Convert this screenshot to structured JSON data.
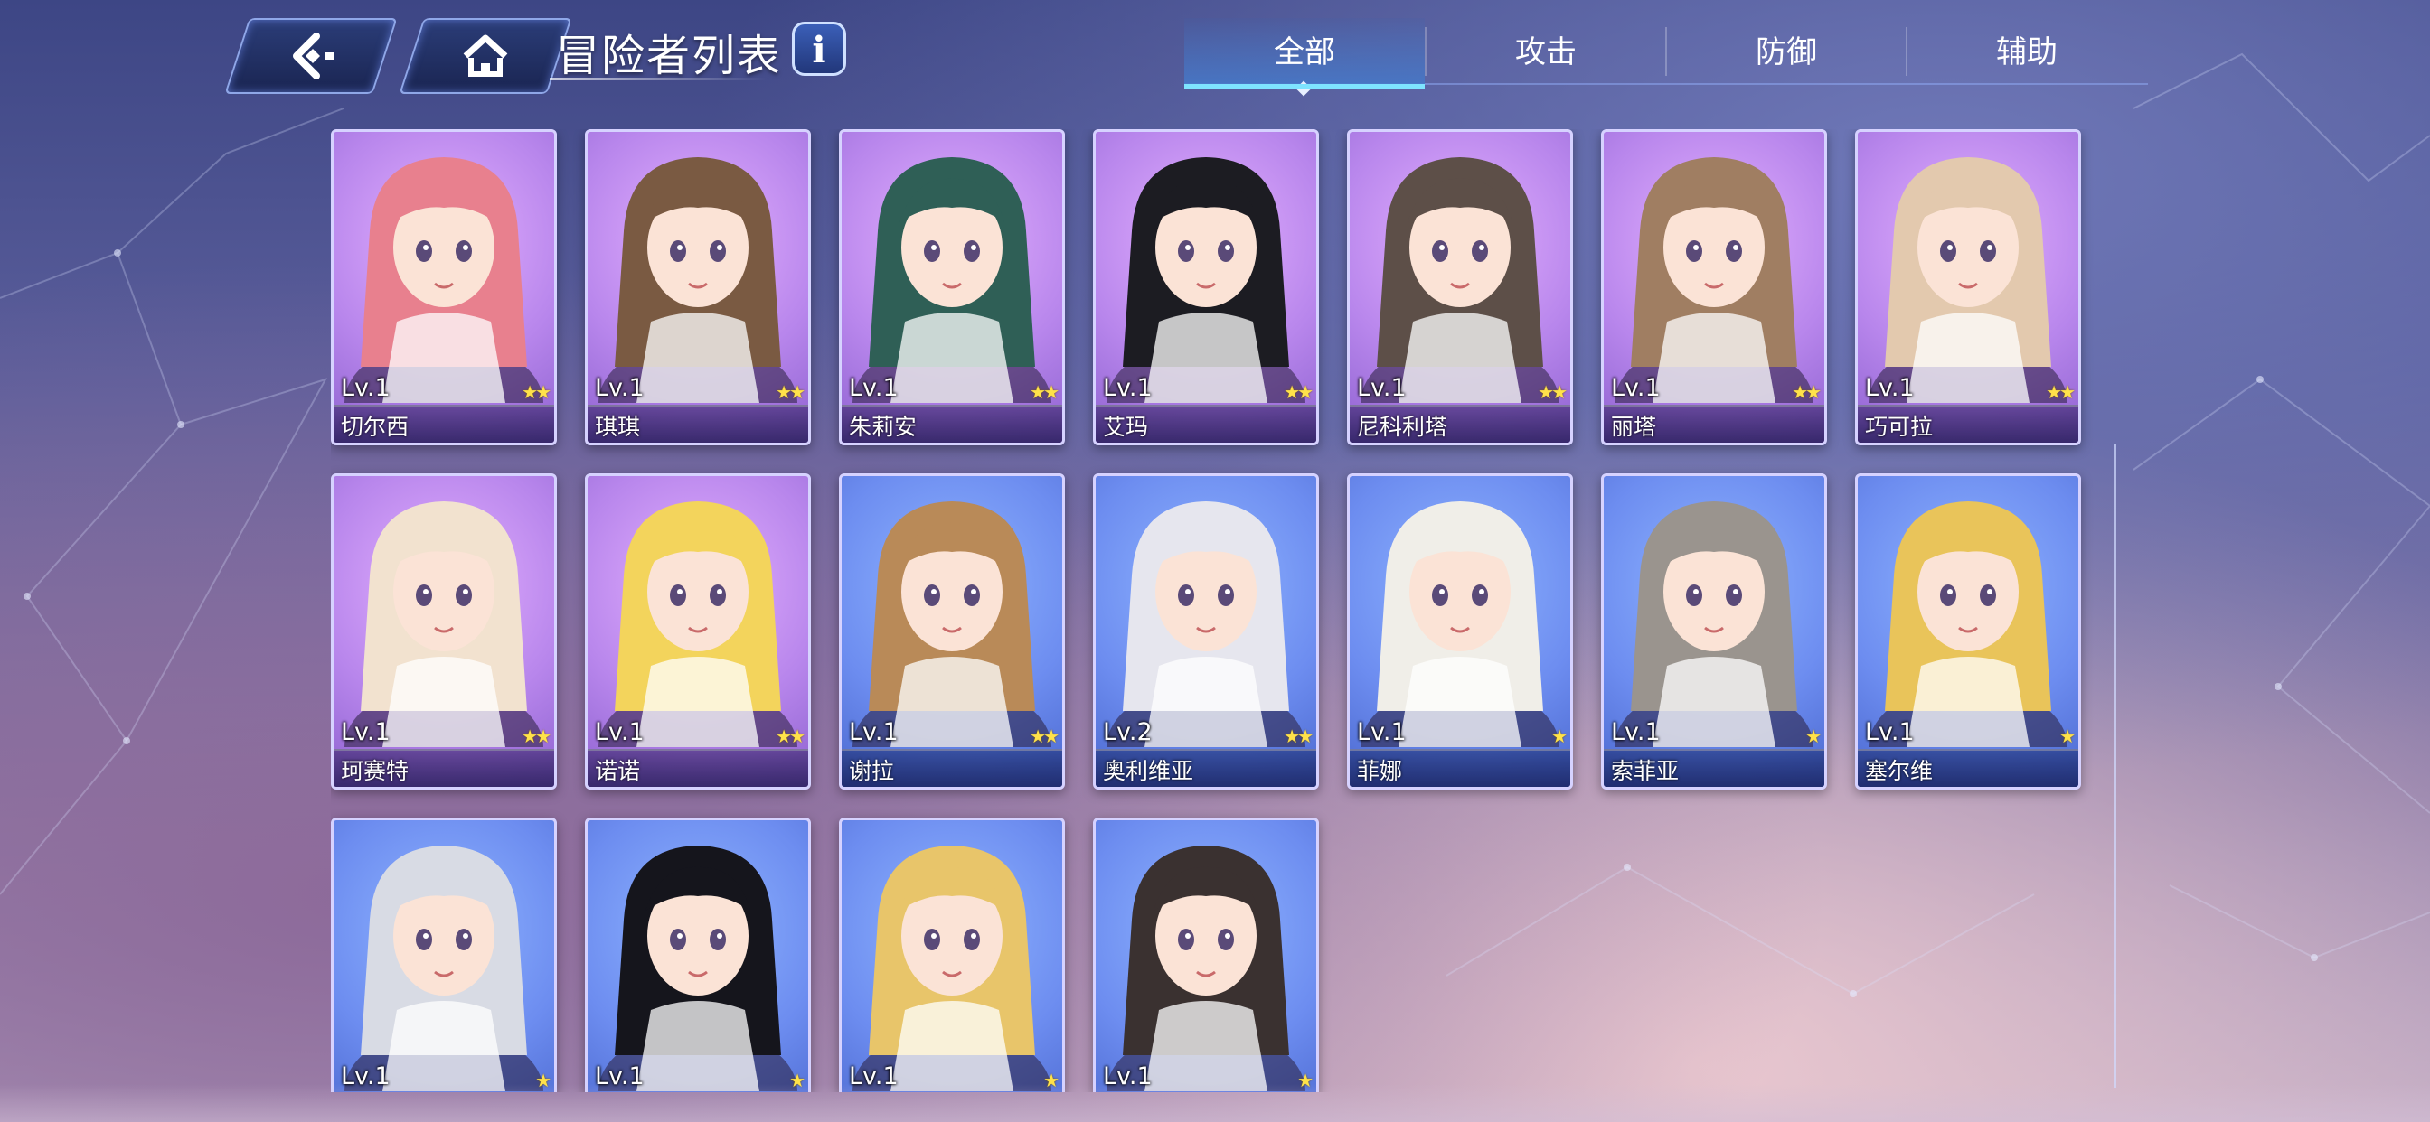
{
  "header": {
    "title": "冒险者列表",
    "back_icon": "back-arrow-icon",
    "home_icon": "home-icon",
    "info_label": "i"
  },
  "tabs": [
    {
      "label": "全部",
      "selected": true
    },
    {
      "label": "攻击",
      "selected": false
    },
    {
      "label": "防御",
      "selected": false
    },
    {
      "label": "辅助",
      "selected": false
    }
  ],
  "colors": {
    "purple_card": "#b886ec",
    "blue_card": "#6d8df0",
    "tab_accent": "#7ee4ff",
    "star": "#ffe24a"
  },
  "adventurers": [
    {
      "level": "Lv.1",
      "name": "切尔西",
      "stars": 2,
      "frame": "purple",
      "hair": "#e8808e"
    },
    {
      "level": "Lv.1",
      "name": "琪琪",
      "stars": 2,
      "frame": "purple",
      "hair": "#7a5a42"
    },
    {
      "level": "Lv.1",
      "name": "朱莉安",
      "stars": 2,
      "frame": "purple",
      "hair": "#2f5f56"
    },
    {
      "level": "Lv.1",
      "name": "艾玛",
      "stars": 2,
      "frame": "purple",
      "hair": "#1c1c22"
    },
    {
      "level": "Lv.1",
      "name": "尼科利塔",
      "stars": 2,
      "frame": "purple",
      "hair": "#5d4f48"
    },
    {
      "level": "Lv.1",
      "name": "丽塔",
      "stars": 2,
      "frame": "purple",
      "hair": "#a07e62"
    },
    {
      "level": "Lv.1",
      "name": "巧可拉",
      "stars": 2,
      "frame": "purple",
      "hair": "#e3c9ae"
    },
    {
      "level": "Lv.1",
      "name": "珂赛特",
      "stars": 2,
      "frame": "purple",
      "hair": "#f2e2cf"
    },
    {
      "level": "Lv.1",
      "name": "诺诺",
      "stars": 2,
      "frame": "purple",
      "hair": "#f3d45c"
    },
    {
      "level": "Lv.1",
      "name": "谢拉",
      "stars": 2,
      "frame": "blue",
      "hair": "#b98a58"
    },
    {
      "level": "Lv.2",
      "name": "奥利维亚",
      "stars": 2,
      "frame": "blue",
      "hair": "#e6e6ee"
    },
    {
      "level": "Lv.1",
      "name": "菲娜",
      "stars": 1,
      "frame": "blue",
      "hair": "#f0eee8"
    },
    {
      "level": "Lv.1",
      "name": "索菲亚",
      "stars": 1,
      "frame": "blue",
      "hair": "#9a948e"
    },
    {
      "level": "Lv.1",
      "name": "塞尔维",
      "stars": 1,
      "frame": "blue",
      "hair": "#e9c45a"
    },
    {
      "level": "Lv.1",
      "name": "",
      "stars": 1,
      "frame": "blue",
      "hair": "#d8dbe4"
    },
    {
      "level": "Lv.1",
      "name": "",
      "stars": 1,
      "frame": "blue",
      "hair": "#15151c"
    },
    {
      "level": "Lv.1",
      "name": "",
      "stars": 1,
      "frame": "blue",
      "hair": "#e8c56a"
    },
    {
      "level": "Lv.1",
      "name": "",
      "stars": 1,
      "frame": "blue",
      "hair": "#3a3130"
    }
  ]
}
